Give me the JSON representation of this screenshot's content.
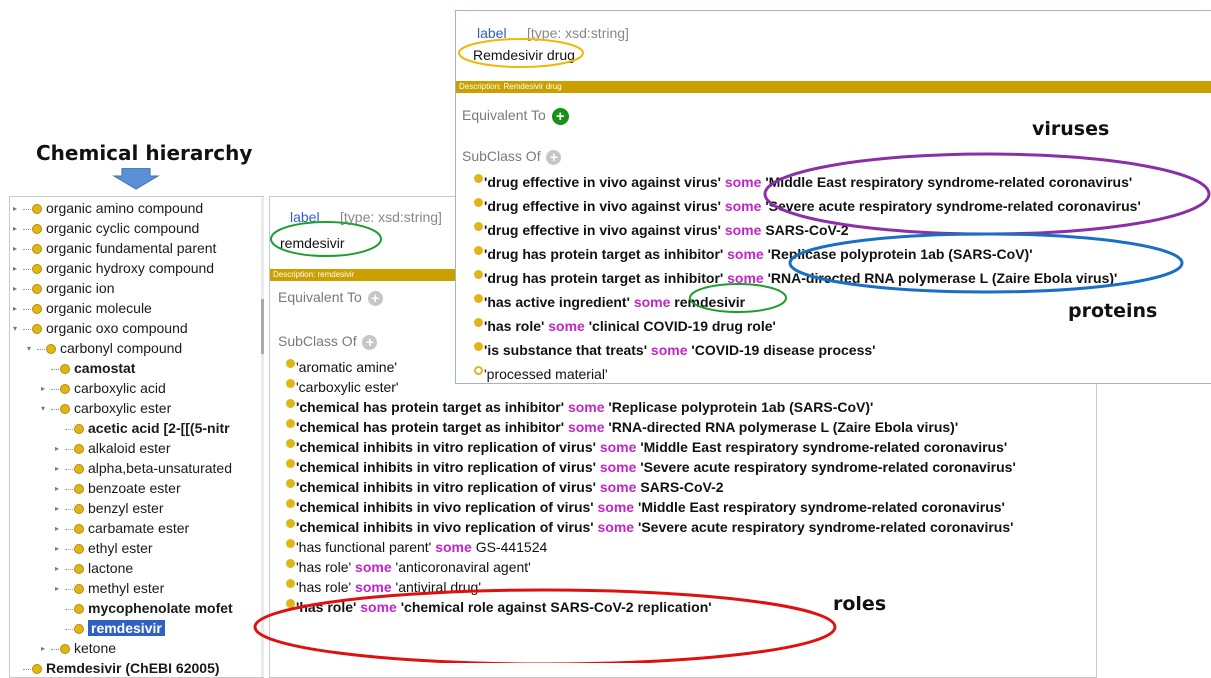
{
  "heading": "Chemical hierarchy",
  "labels": {
    "viruses": "viruses",
    "proteins": "proteins",
    "roles": "roles"
  },
  "colors": {
    "accent_blue": "#2f5fc8",
    "keyword": "#c026c7",
    "gold": "#e0b515",
    "desc_bar": "#c9a000",
    "ellipse_purple": "#8b2fa8",
    "ellipse_blue": "#1a6fc4",
    "ellipse_red": "#e01010",
    "ellipse_green": "#1f9d2e",
    "ellipse_yellow": "#f2b705"
  },
  "tree": [
    {
      "text": "organic amino compound",
      "indent": 0,
      "tri": "▸",
      "bold": false,
      "sel": false
    },
    {
      "text": "organic cyclic compound",
      "indent": 0,
      "tri": "▸",
      "bold": false,
      "sel": false
    },
    {
      "text": "organic fundamental parent",
      "indent": 0,
      "tri": "▸",
      "bold": false,
      "sel": false
    },
    {
      "text": "organic hydroxy compound",
      "indent": 0,
      "tri": "▸",
      "bold": false,
      "sel": false
    },
    {
      "text": "organic ion",
      "indent": 0,
      "tri": "▸",
      "bold": false,
      "sel": false
    },
    {
      "text": "organic molecule",
      "indent": 0,
      "tri": "▸",
      "bold": false,
      "sel": false
    },
    {
      "text": "organic oxo compound",
      "indent": 0,
      "tri": "▾",
      "bold": false,
      "sel": false
    },
    {
      "text": "carbonyl compound",
      "indent": 1,
      "tri": "▾",
      "bold": false,
      "sel": false
    },
    {
      "text": "camostat",
      "indent": 2,
      "tri": "",
      "bold": true,
      "sel": false
    },
    {
      "text": "carboxylic acid",
      "indent": 2,
      "tri": "▸",
      "bold": false,
      "sel": false
    },
    {
      "text": "carboxylic ester",
      "indent": 2,
      "tri": "▾",
      "bold": false,
      "sel": false
    },
    {
      "text": "acetic acid [2-[[(5-nitr",
      "indent": 3,
      "tri": "",
      "bold": true,
      "sel": false
    },
    {
      "text": "alkaloid ester",
      "indent": 3,
      "tri": "▸",
      "bold": false,
      "sel": false
    },
    {
      "text": "alpha,beta-unsaturated",
      "indent": 3,
      "tri": "▸",
      "bold": false,
      "sel": false
    },
    {
      "text": "benzoate ester",
      "indent": 3,
      "tri": "▸",
      "bold": false,
      "sel": false
    },
    {
      "text": "benzyl ester",
      "indent": 3,
      "tri": "▸",
      "bold": false,
      "sel": false
    },
    {
      "text": "carbamate ester",
      "indent": 3,
      "tri": "▸",
      "bold": false,
      "sel": false
    },
    {
      "text": "ethyl ester",
      "indent": 3,
      "tri": "▸",
      "bold": false,
      "sel": false
    },
    {
      "text": "lactone",
      "indent": 3,
      "tri": "▸",
      "bold": false,
      "sel": false
    },
    {
      "text": "methyl ester",
      "indent": 3,
      "tri": "▸",
      "bold": false,
      "sel": false
    },
    {
      "text": "mycophenolate mofet",
      "indent": 3,
      "tri": "",
      "bold": true,
      "sel": false
    },
    {
      "text": "remdesivir",
      "indent": 3,
      "tri": "",
      "bold": true,
      "sel": true
    },
    {
      "text": "ketone",
      "indent": 2,
      "tri": "▸",
      "bold": false,
      "sel": false
    },
    {
      "text": "Remdesivir (ChEBI 62005)",
      "indent": 0,
      "tri": "",
      "bold": true,
      "sel": false
    }
  ],
  "mid": {
    "label_key": "label",
    "label_type": "[type: xsd:string]",
    "label_value": "remdesivir",
    "description": "Description: remdesivir",
    "equivalent_to": "Equivalent To",
    "subclass_of": "SubClass Of",
    "axioms": [
      {
        "pre": "'aromatic amine'",
        "kw": "",
        "post": "",
        "bold": false
      },
      {
        "pre": "'carboxylic ester'",
        "kw": "",
        "post": "",
        "bold": false
      },
      {
        "pre": "'chemical has protein target as inhibitor'",
        "kw": "some",
        "post": "'Replicase polyprotein 1ab (SARS-CoV)'",
        "bold": true
      },
      {
        "pre": "'chemical has protein target as inhibitor'",
        "kw": "some",
        "post": "'RNA-directed RNA polymerase L (Zaire Ebola virus)'",
        "bold": true
      },
      {
        "pre": "'chemical inhibits in vitro replication of virus'",
        "kw": "some",
        "post": "'Middle East respiratory syndrome-related coronavirus'",
        "bold": true
      },
      {
        "pre": "'chemical inhibits in vitro replication of virus'",
        "kw": "some",
        "post": "'Severe acute respiratory syndrome-related coronavirus'",
        "bold": true
      },
      {
        "pre": "'chemical inhibits in vitro replication of virus'",
        "kw": "some",
        "post": "SARS-CoV-2",
        "bold": true
      },
      {
        "pre": "'chemical inhibits in vivo replication of virus'",
        "kw": "some",
        "post": "'Middle East respiratory syndrome-related coronavirus'",
        "bold": true
      },
      {
        "pre": "'chemical inhibits in vivo replication of virus'",
        "kw": "some",
        "post": "'Severe acute respiratory syndrome-related coronavirus'",
        "bold": true
      },
      {
        "pre": "'has functional parent'",
        "kw": "some",
        "post": "GS-441524",
        "bold": false
      },
      {
        "pre": "'has role'",
        "kw": "some",
        "post": "'anticoronaviral agent'",
        "bold": false
      },
      {
        "pre": "'has role'",
        "kw": "some",
        "post": "'antiviral drug'",
        "bold": false
      },
      {
        "pre": "'has role'",
        "kw": "some",
        "post": "'chemical role against SARS-CoV-2 replication'",
        "bold": true
      }
    ]
  },
  "top": {
    "label_key": "label",
    "label_type": "[type: xsd:string]",
    "label_value": "Remdesivir drug",
    "description": "Description: Remdesivir drug",
    "equivalent_to": "Equivalent To",
    "subclass_of": "SubClass Of",
    "axioms": [
      {
        "pre": "'drug effective in vivo against virus'",
        "kw": "some",
        "post": "'Middle East respiratory syndrome-related coronavirus'",
        "hollow": false
      },
      {
        "pre": "'drug effective in vivo against virus'",
        "kw": "some",
        "post": "'Severe acute respiratory syndrome-related coronavirus'",
        "hollow": false
      },
      {
        "pre": "'drug effective in vivo against virus'",
        "kw": "some",
        "post": "SARS-CoV-2",
        "hollow": false
      },
      {
        "pre": "'drug has protein target as inhibitor'",
        "kw": "some",
        "post": "'Replicase polyprotein 1ab (SARS-CoV)'",
        "hollow": false
      },
      {
        "pre": "'drug has protein target as inhibitor'",
        "kw": "some",
        "post": "'RNA-directed RNA polymerase L (Zaire Ebola virus)'",
        "hollow": false
      },
      {
        "pre": "'has active ingredient'",
        "kw": "some",
        "post": "remdesivir",
        "hollow": false
      },
      {
        "pre": "'has role'",
        "kw": "some",
        "post": "'clinical COVID-19 drug role'",
        "hollow": false
      },
      {
        "pre": "'is substance that treats'",
        "kw": "some",
        "post": "'COVID-19 disease process'",
        "hollow": false
      },
      {
        "pre": "'processed material'",
        "kw": "",
        "post": "",
        "hollow": true
      }
    ]
  }
}
